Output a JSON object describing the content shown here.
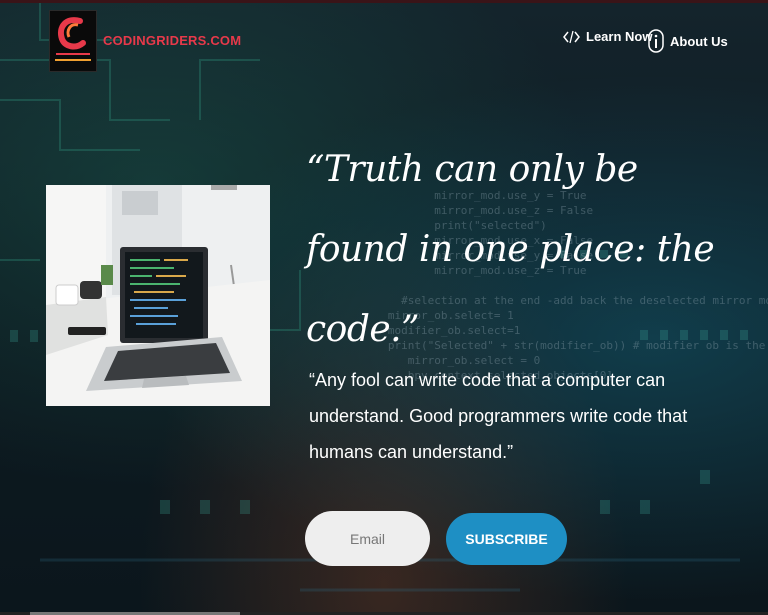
{
  "site": {
    "name": "CODINGRIDERS.COM",
    "logo_text_top": "CODING RIDERS",
    "logo_text_bottom": "KNOWLEDGE IS POWER"
  },
  "nav": {
    "learn": {
      "label": "Learn Now",
      "icon": "code-icon"
    },
    "about": {
      "label": "About Us",
      "icon": "info-icon"
    }
  },
  "hero": {
    "quote_main": "“Truth can only be found in one place: the code.”",
    "quote_sub": "“Any fool can write code that a computer can understand. Good programmers write code that humans can understand.”"
  },
  "signup": {
    "email_placeholder": "Email",
    "button_label": "SUBSCRIBE"
  },
  "colors": {
    "brand_red": "#e8394a",
    "button_blue": "#1e8fc4",
    "text_white": "#ffffff"
  }
}
